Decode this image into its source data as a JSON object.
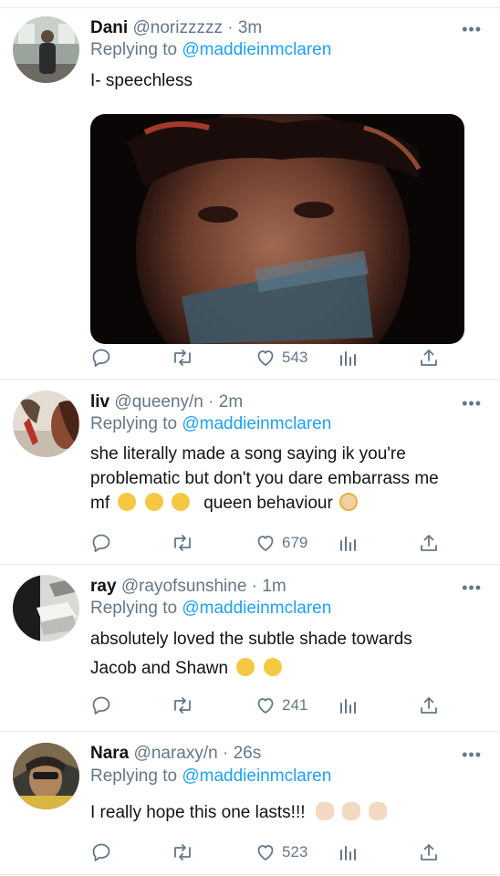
{
  "reply_prefix": "Replying to",
  "tweets": [
    {
      "name": "Dani",
      "handle": "@norizzzzz",
      "time": "3m",
      "reply_to": "@maddieinmclaren",
      "text": "I- speechless",
      "has_media": true,
      "likes": "543"
    },
    {
      "name": "liv",
      "handle": "@queeny/n",
      "time": "2m",
      "reply_to": "@maddieinmclaren",
      "text_line1": "she literally made a song saying ik you're",
      "text_line2": "problematic but don't you dare embarrass me",
      "text_line3a": "mf",
      "text_line3b": "queen behaviour",
      "likes": "679"
    },
    {
      "name": "ray",
      "handle": "@rayofsunshine",
      "time": "1m",
      "reply_to": "@maddieinmclaren",
      "text_line1": "absolutely loved the subtle shade towards",
      "text_line2": "Jacob and Shawn",
      "likes": "241"
    },
    {
      "name": "Nara",
      "handle": "@naraxy/n",
      "time": "26s",
      "reply_to": "@maddieinmclaren",
      "text": "I really hope this one lasts!!!",
      "likes": "523"
    }
  ],
  "colors": {
    "link": "#1da1f2",
    "secondary": "#657786",
    "divider": "#e6ecf0"
  },
  "icons": [
    "reply-icon",
    "retweet-icon",
    "like-icon",
    "analytics-icon",
    "share-icon",
    "more-icon"
  ]
}
